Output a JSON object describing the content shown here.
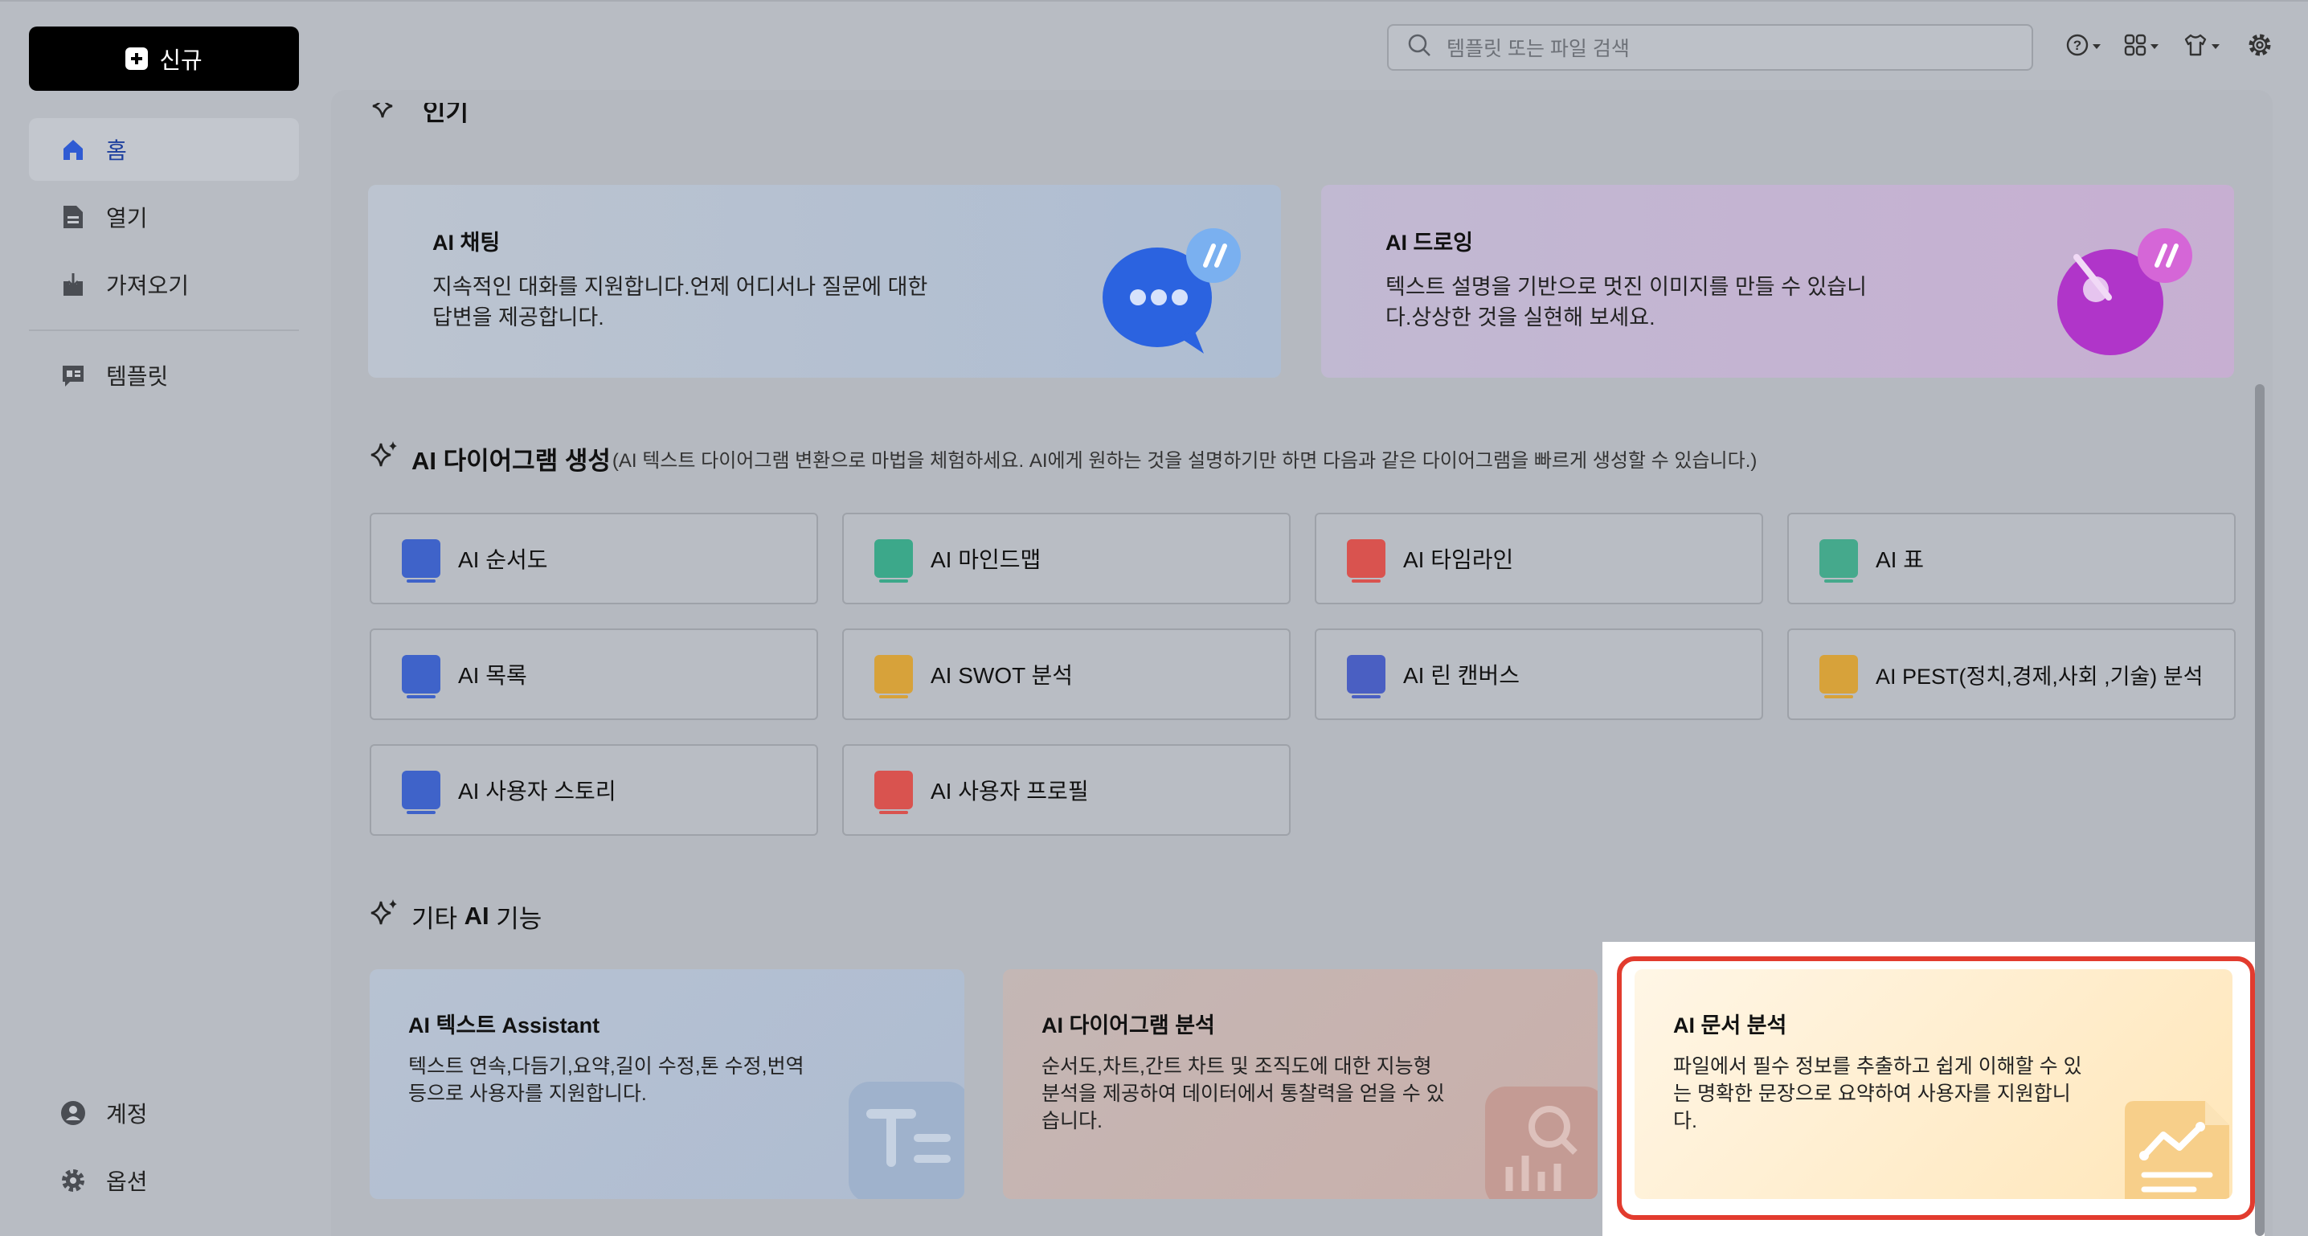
{
  "sidebar": {
    "new_label": "신규",
    "items": [
      {
        "label": "홈",
        "icon": "home-icon"
      },
      {
        "label": "열기",
        "icon": "document-icon"
      },
      {
        "label": "가져오기",
        "icon": "import-icon"
      },
      {
        "label": "템플릿",
        "icon": "template-icon"
      }
    ],
    "bottom": [
      {
        "label": "계정",
        "icon": "account-icon"
      },
      {
        "label": "옵션",
        "icon": "gear-icon"
      }
    ]
  },
  "header": {
    "search_placeholder": "템플릿 또는 파일 검색",
    "icons": [
      "help-icon",
      "apps-icon",
      "shirt-icon",
      "settings-icon"
    ]
  },
  "sections": {
    "top_partial_title": "인기",
    "diagram_title": "AI 다이어그램 생성",
    "diagram_subtitle": "(AI 텍스트 다이어그램 변환으로 마법을 체험하세요. AI에게 원하는 것을 설명하기만 하면 다음과 같은 다이어그램을 빠르게 생성할 수 있습니다.)",
    "other_title_prefix": "기타 ",
    "other_title_bold": "AI",
    "other_title_suffix": " 기능"
  },
  "banners": [
    {
      "title": "AI 채팅",
      "desc": "지속적인 대화를 지원합니다.언제 어디서나 질문에 대한 답변을 제공합니다."
    },
    {
      "title": "AI 드로잉",
      "desc": "텍스트 설명을 기반으로 멋진 이미지를 만들 수 있습니다.상상한 것을 실현해 보세요."
    }
  ],
  "tiles": [
    {
      "label": "AI 순서도",
      "color": "#3f63c9"
    },
    {
      "label": "AI 마인드맵",
      "color": "#3ca88a"
    },
    {
      "label": "AI 타임라인",
      "color": "#d9534f"
    },
    {
      "label": "AI 표",
      "color": "#45a98c"
    },
    {
      "label": "AI 목록",
      "color": "#3f63c9"
    },
    {
      "label": "AI SWOT 분석",
      "color": "#d7a23a"
    },
    {
      "label": "AI 린 캔버스",
      "color": "#4a5fc2"
    },
    {
      "label": "AI PEST(정치,경제,사회 ,기술) 분석",
      "color": "#d7a23a"
    },
    {
      "label": "AI 사용자 스토리",
      "color": "#3f63c9"
    },
    {
      "label": "AI 사용자 프로필",
      "color": "#d9534f"
    }
  ],
  "cards": [
    {
      "title": "AI 텍스트 Assistant",
      "desc": "텍스트 연속,다듬기,요약,길이 수정,톤 수정,번역 등으로 사용자를 지원합니다.",
      "icon": "text-icon"
    },
    {
      "title": "AI 다이어그램 분석",
      "desc": "순서도,차트,간트 차트 및 조직도에 대한 지능형 분석을 제공하여 데이터에서 통찰력을 얻을 수 있습니다.",
      "icon": "chart-analysis-icon"
    },
    {
      "title": "AI 문서 분석",
      "desc": "파일에서 필수 정보를 추출하고 쉽게 이해할 수 있는 명확한 문장으로 요약하여 사용자를 지원합니다.",
      "icon": "document-chart-icon"
    }
  ]
}
